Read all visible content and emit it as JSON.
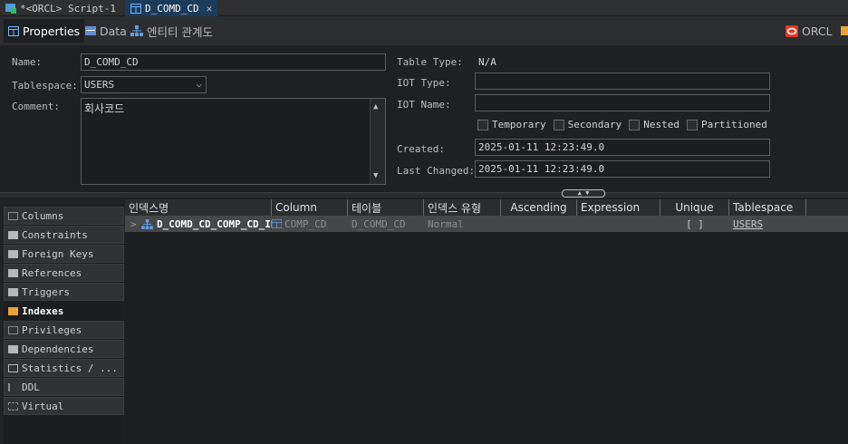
{
  "editor_tabs": [
    {
      "label": "*<ORCL> Script-1"
    },
    {
      "label": "D_COMD_CD"
    }
  ],
  "view_tabs": {
    "properties": "Properties",
    "data": "Data",
    "erd": "엔티티 관계도",
    "connection": "ORCL"
  },
  "props": {
    "name_label": "Name:",
    "name_value": "D_COMD_CD",
    "tablespace_label": "Tablespace:",
    "tablespace_value": "USERS",
    "comment_label": "Comment:",
    "comment_value": "회사코드",
    "table_type_label": "Table Type:",
    "table_type_value": "N/A",
    "iot_type_label": "IOT Type:",
    "iot_type_value": "",
    "iot_name_label": "IOT Name:",
    "iot_name_value": "",
    "checkboxes": {
      "temporary": "Temporary",
      "secondary": "Secondary",
      "nested": "Nested",
      "partitioned": "Partitioned"
    },
    "created_label": "Created:",
    "created_value": "2025-01-11 12:23:49.0",
    "last_changed_label": "Last Changed:",
    "last_changed_value": "2025-01-11 12:23:49.0"
  },
  "nav": {
    "items": [
      {
        "label": "Columns"
      },
      {
        "label": "Constraints"
      },
      {
        "label": "Foreign Keys"
      },
      {
        "label": "References"
      },
      {
        "label": "Triggers"
      },
      {
        "label": "Indexes"
      },
      {
        "label": "Privileges"
      },
      {
        "label": "Dependencies"
      },
      {
        "label": "Statistics / ..."
      },
      {
        "label": "DDL"
      },
      {
        "label": "Virtual"
      }
    ],
    "active": "Indexes"
  },
  "grid": {
    "headers": [
      "인덱스명",
      "Column",
      "테이블",
      "인덱스 유형",
      "Ascending",
      "Expression",
      "Unique",
      "Tablespace"
    ],
    "rows": [
      {
        "expander": ">",
        "index_name": "D_COMD_CD_COMP_CD_IDX",
        "column": "COMP_CD",
        "table": "D_COMD_CD",
        "index_type": "Normal",
        "ascending": "",
        "expression": "",
        "unique": "[ ]",
        "tablespace": "USERS"
      }
    ]
  },
  "colors": {
    "accent": "#1c3a5a",
    "folder": "#e8a33a",
    "oracle_red": "#e03a2a"
  }
}
